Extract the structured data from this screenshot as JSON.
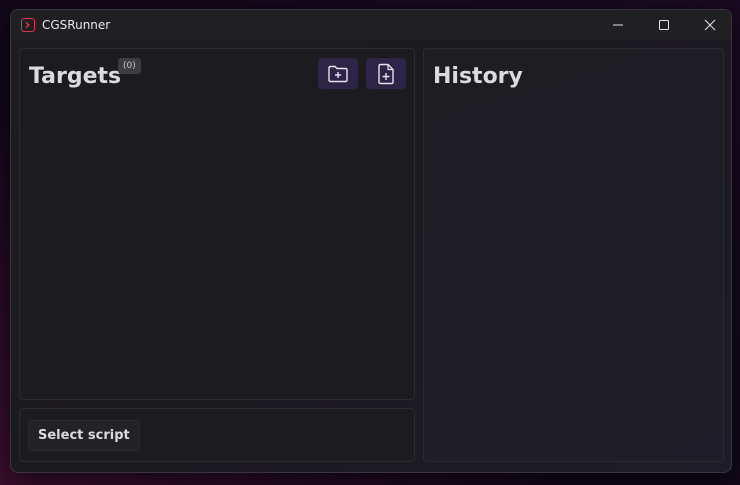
{
  "window": {
    "title": "CGSRunner",
    "app_icon": "terminal-prompt-icon",
    "controls": [
      "minimize-icon",
      "maximize-icon",
      "close-icon"
    ]
  },
  "targets": {
    "heading": "Targets",
    "count": "(0)",
    "buttons": [
      "add-folder-icon",
      "add-file-icon"
    ]
  },
  "script": {
    "select_label": "Select script"
  },
  "history": {
    "heading": "History"
  },
  "colors": {
    "accent": "#2e2448",
    "app_icon": "#e0344e"
  }
}
